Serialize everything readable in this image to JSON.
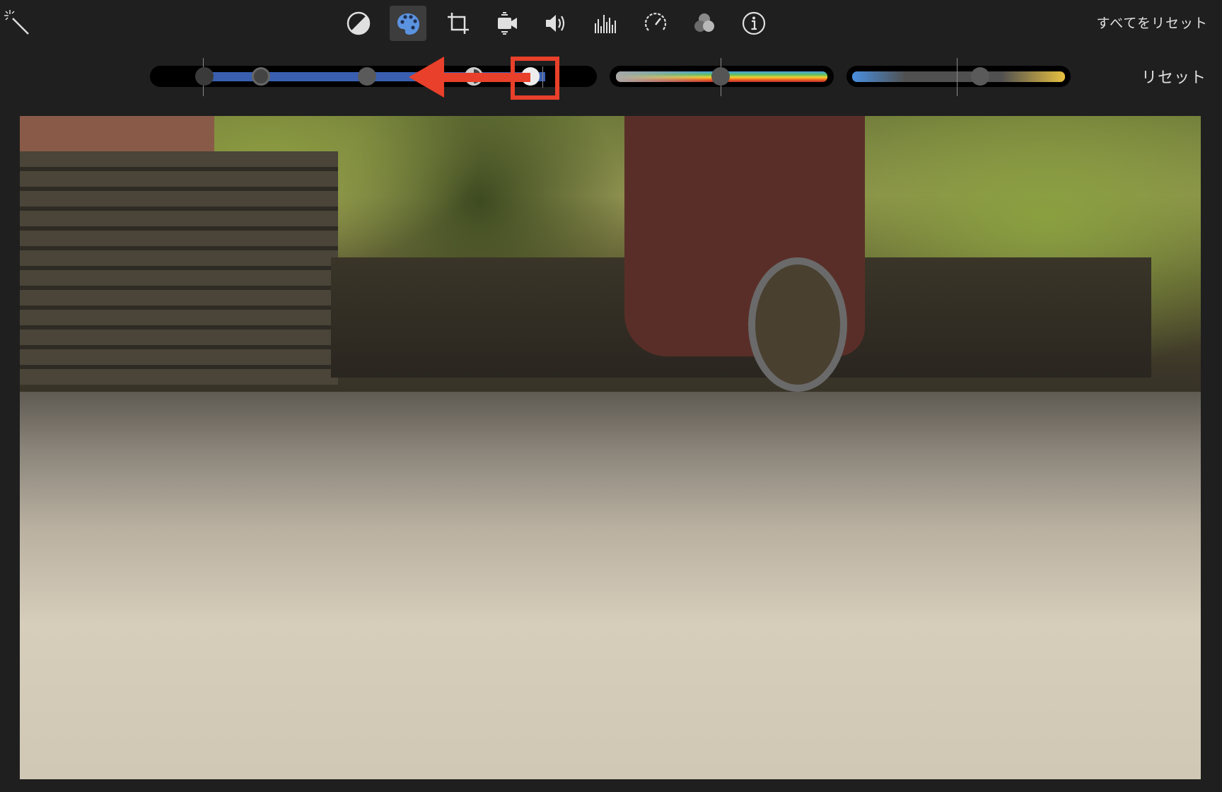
{
  "toolbar": {
    "tools": [
      {
        "name": "magic-wand-icon"
      },
      {
        "name": "color-balance-icon"
      },
      {
        "name": "color-correction-icon",
        "active": true
      },
      {
        "name": "crop-icon"
      },
      {
        "name": "stabilization-icon"
      },
      {
        "name": "volume-icon"
      },
      {
        "name": "noise-reduction-equalizer-icon"
      },
      {
        "name": "speed-icon"
      },
      {
        "name": "video-overlay-icon"
      },
      {
        "name": "info-icon"
      }
    ],
    "reset_all_label": "すべてをリセット"
  },
  "color_controls": {
    "reset_label": "リセット",
    "accent_color": "#3a5fb0",
    "highlight_color": "#e8402a",
    "sliders": [
      {
        "name": "brightness-contrast",
        "knobs": [
          0,
          0.13,
          0.41,
          0.68,
          0.82
        ]
      },
      {
        "name": "saturation",
        "value": 0.5
      },
      {
        "name": "temperature",
        "value": 0.6
      }
    ]
  }
}
